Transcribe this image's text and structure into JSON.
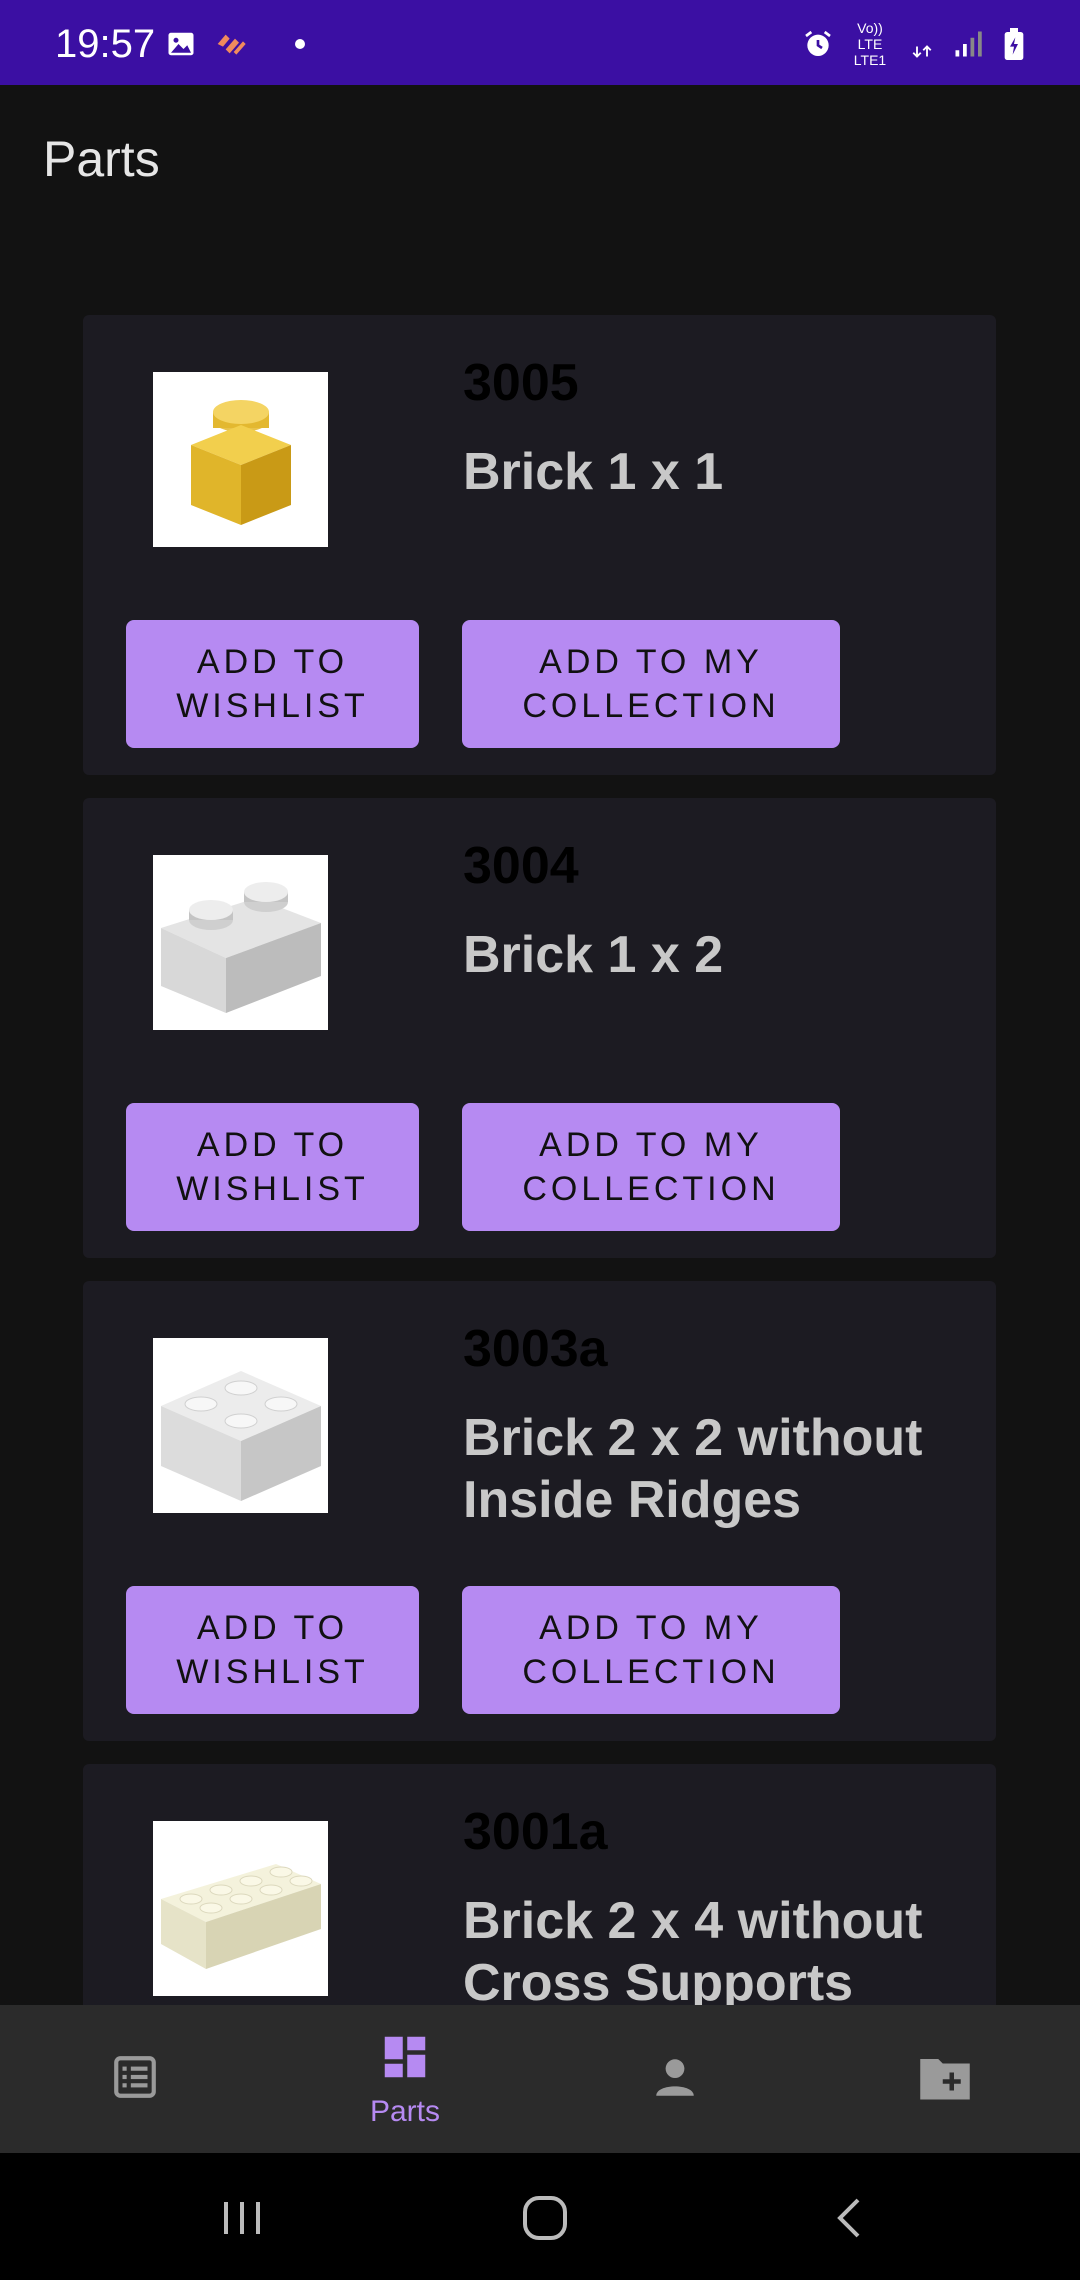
{
  "status_bar": {
    "time": "19:57",
    "network_label_top": "Vo)) LTE",
    "network_label_bottom": "LTE1",
    "icons": [
      "gallery-icon",
      "health-icon",
      "dot-icon",
      "alarm-icon",
      "volte-icon",
      "lte-icon",
      "signal-icon",
      "battery-icon"
    ]
  },
  "header": {
    "title": "Parts"
  },
  "parts": [
    {
      "number": "3005",
      "name": "Brick 1 x 1",
      "image": "yellow-brick-1x1",
      "wishlist_label": "ADD TO WISHLIST",
      "collection_label": "ADD TO MY COLLECTION"
    },
    {
      "number": "3004",
      "name": "Brick 1 x 2",
      "image": "grey-brick-1x2",
      "wishlist_label": "ADD TO WISHLIST",
      "collection_label": "ADD TO MY COLLECTION"
    },
    {
      "number": "3003a",
      "name": "Brick 2 x 2 without Inside Ridges",
      "image": "white-brick-2x2",
      "wishlist_label": "ADD TO WISHLIST",
      "collection_label": "ADD TO MY COLLECTION"
    },
    {
      "number": "3001a",
      "name": "Brick 2 x 4 without Cross Supports",
      "image": "cream-brick-2x4"
    }
  ],
  "bottom_nav": {
    "items": [
      {
        "icon": "list-icon",
        "label": ""
      },
      {
        "icon": "dashboard-icon",
        "label": "Parts",
        "active": true
      },
      {
        "icon": "person-icon",
        "label": ""
      },
      {
        "icon": "folder-add-icon",
        "label": ""
      }
    ]
  },
  "colors": {
    "status_bar": "#3b0fa3",
    "accent": "#b68af2",
    "card_bg": "#1c1b22",
    "app_bg": "#121212"
  }
}
